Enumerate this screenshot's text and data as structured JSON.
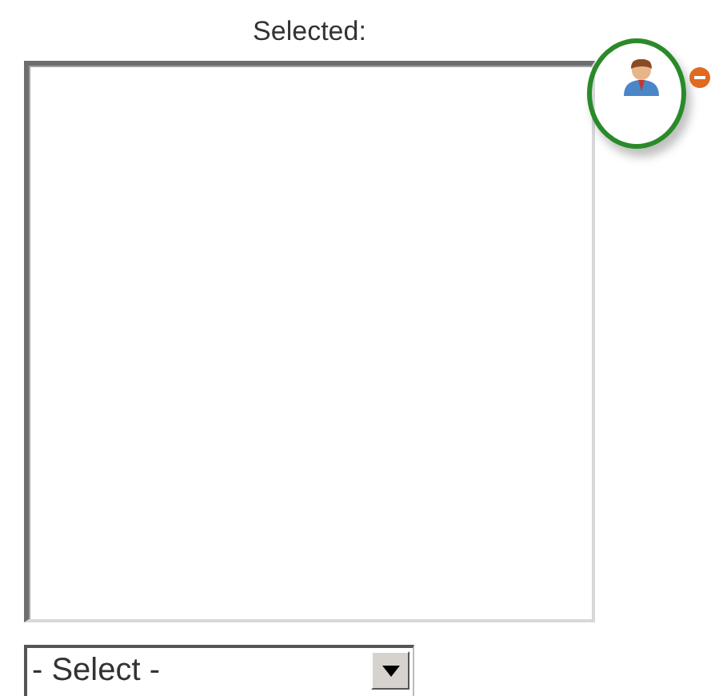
{
  "selected_label": "Selected:",
  "select": {
    "value": "- Select -"
  }
}
